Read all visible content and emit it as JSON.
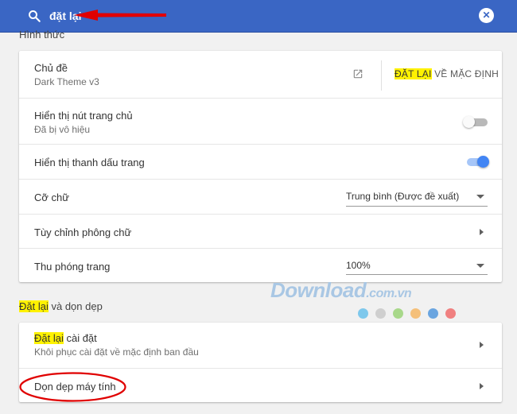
{
  "search": {
    "value": "đặt lại",
    "icon": "search-icon",
    "clear_icon": "close-icon"
  },
  "section_appearance": {
    "label": "Hình thức"
  },
  "appearance": {
    "theme": {
      "title": "Chủ đề",
      "subtitle": "Dark Theme v3",
      "reset_highlight": "ĐẶT LẠI",
      "reset_rest": " VỀ MẶC ĐỊNH"
    },
    "home_button": {
      "title": "Hiển thị nút trang chủ",
      "subtitle": "Đã bị vô hiệu",
      "enabled": false
    },
    "bookmarks_bar": {
      "title": "Hiển thị thanh dấu trang",
      "enabled": true
    },
    "font_size": {
      "title": "Cỡ chữ",
      "value": "Trung bình (Được đề xuất)"
    },
    "customize_fonts": {
      "title": "Tùy chỉnh phông chữ"
    },
    "page_zoom": {
      "title": "Thu phóng trang",
      "value": "100%"
    }
  },
  "section_reset": {
    "highlight": "Đặt lại",
    "rest": " và dọn dẹp"
  },
  "reset": {
    "restore": {
      "title_highlight": "Đặt lại",
      "title_rest": " cài đặt",
      "subtitle": "Khôi phục cài đặt về mặc định ban đầu"
    },
    "cleanup": {
      "title": "Dọn dẹp máy tính"
    }
  },
  "watermark": {
    "text": "Download",
    "suffix": ".com.vn"
  },
  "colors": {
    "search_bar": "#3a66c4",
    "toggle_on": "#4285f4",
    "highlight": "#fff200",
    "annotation": "#e00000",
    "dots": [
      "#7ec8ec",
      "#cfcfcf",
      "#a8d88a",
      "#f5c07a",
      "#6aa5e0",
      "#f08080"
    ]
  }
}
